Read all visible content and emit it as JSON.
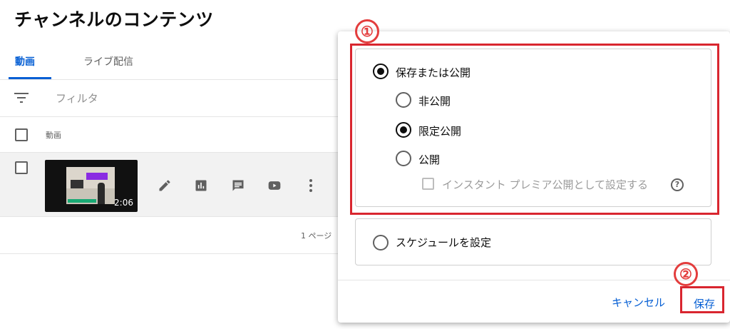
{
  "page": {
    "title": "チャンネルのコンテンツ",
    "tabs": [
      {
        "label": "動画",
        "active": true
      },
      {
        "label": "ライブ配信",
        "active": false
      }
    ],
    "filter_placeholder": "フィルタ",
    "table_header": "動画",
    "video": {
      "duration": "2:06",
      "actions": [
        "edit-icon",
        "analytics-icon",
        "comments-icon",
        "youtube-icon",
        "more-icon"
      ]
    },
    "pagination_text": "1 ページ"
  },
  "dialog": {
    "save_or_publish": {
      "label": "保存または公開",
      "selected": true
    },
    "visibility_options": [
      {
        "label": "非公開",
        "selected": false
      },
      {
        "label": "限定公開",
        "selected": true
      },
      {
        "label": "公開",
        "selected": false
      }
    ],
    "premiere_label": "インスタント プレミア公開として設定する",
    "premiere_checked": false,
    "schedule": {
      "label": "スケジュールを設定",
      "selected": false
    },
    "cancel_label": "キャンセル",
    "save_label": "保存"
  },
  "annotations": {
    "callout_1": "①",
    "callout_2": "②",
    "color": "#d9262f"
  },
  "colors": {
    "accent": "#065fd4"
  }
}
